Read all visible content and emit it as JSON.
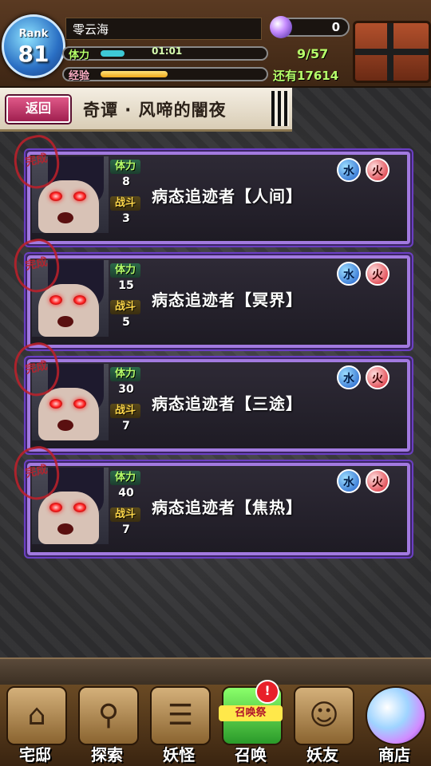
{
  "header": {
    "rank_label": "Rank",
    "rank_value": "81",
    "player_name": "零云海",
    "stamina_label": "体力",
    "stamina_timer": "01:01",
    "stamina_fill": 0.15,
    "exp_label": "经验",
    "exp_fill": 0.42,
    "orb_count": "0",
    "box_count": "9/57",
    "remaining": "还有17614"
  },
  "title_bar": {
    "back_label": "返回",
    "stage_title": "奇谭 · 风啼的闇夜"
  },
  "quests": [
    {
      "seal": "完成",
      "stamina_label": "体力",
      "stamina": "8",
      "battle_label": "战斗",
      "battles": "3",
      "name": "病态追迹者【人间】",
      "elem1": "水",
      "elem2": "火"
    },
    {
      "seal": "完成",
      "stamina_label": "体力",
      "stamina": "15",
      "battle_label": "战斗",
      "battles": "5",
      "name": "病态追迹者【冥界】",
      "elem1": "水",
      "elem2": "火"
    },
    {
      "seal": "完成",
      "stamina_label": "体力",
      "stamina": "30",
      "battle_label": "战斗",
      "battles": "7",
      "name": "病态追迹者【三途】",
      "elem1": "水",
      "elem2": "火"
    },
    {
      "seal": "完成",
      "stamina_label": "体力",
      "stamina": "40",
      "battle_label": "战斗",
      "battles": "7",
      "name": "病态追迹者【焦热】",
      "elem1": "水",
      "elem2": "火"
    }
  ],
  "nav": {
    "home": "宅邸",
    "explore": "探索",
    "yokai": "妖怪",
    "summon": "召唤",
    "summon_festival": "召唤祭",
    "summon_alert": "!",
    "friends": "妖友",
    "shop": "商店"
  },
  "colors": {
    "card_border": "#a27ae0",
    "stamina_text": "#b6ff6a",
    "battle_text": "#ffd84a"
  }
}
